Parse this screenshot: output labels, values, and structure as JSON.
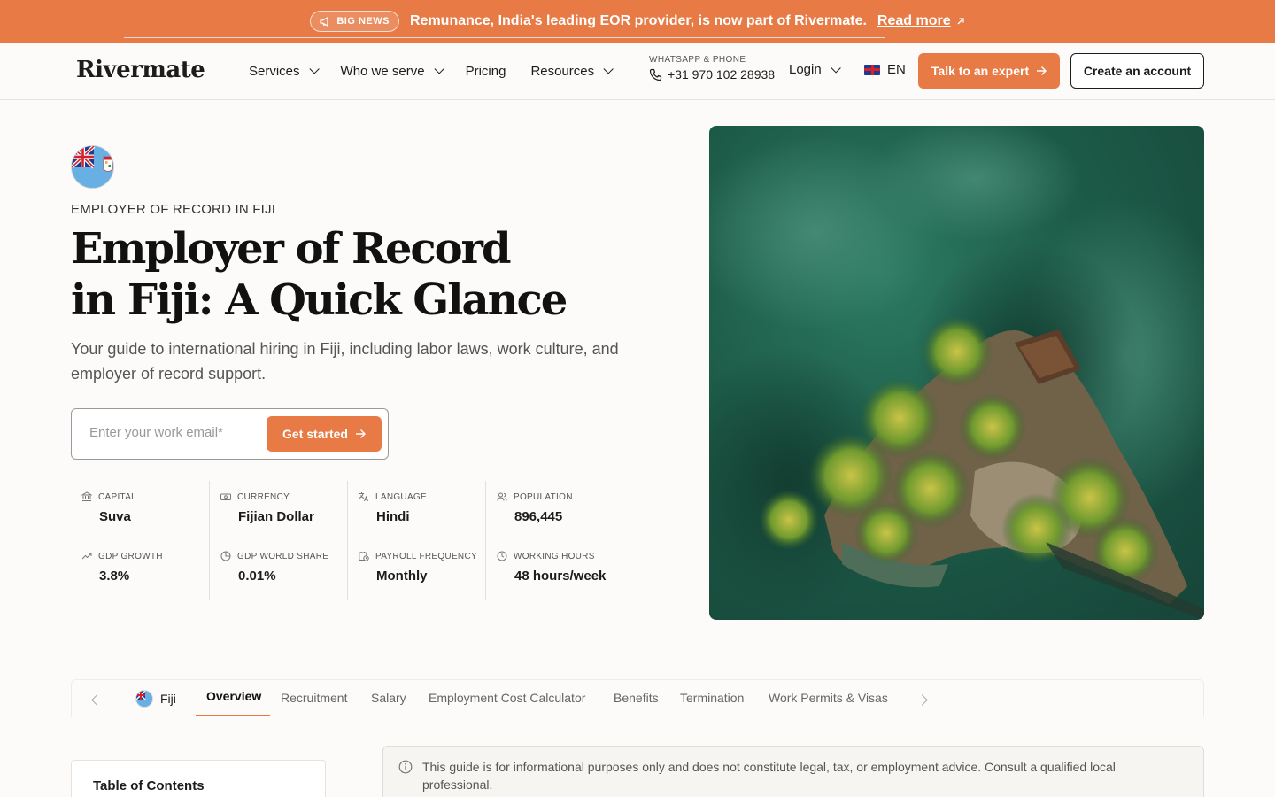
{
  "announcement": {
    "badge": "BIG NEWS",
    "text": "Remunance, India's leading EOR provider, is now part of Rivermate.",
    "link": "Read more"
  },
  "header": {
    "logo": "Rivermate",
    "nav": [
      {
        "label": "Services",
        "dropdown": true
      },
      {
        "label": "Who we serve",
        "dropdown": true
      },
      {
        "label": "Pricing",
        "dropdown": false
      },
      {
        "label": "Resources",
        "dropdown": true
      }
    ],
    "contact_label": "WHATSAPP & PHONE",
    "phone": "+31 970 102 28938",
    "login": "Login",
    "language": "EN",
    "cta_primary": "Talk to an expert",
    "cta_secondary": "Create an account"
  },
  "hero": {
    "eyebrow": "EMPLOYER OF RECORD IN FIJI",
    "title_line1": "Employer of Record",
    "title_line2": "in Fiji: A Quick Glance",
    "subtitle": "Your guide to international hiring in Fiji, including labor laws, work culture, and employer of record support.",
    "email_placeholder": "Enter your work email*",
    "get_started": "Get started"
  },
  "stats": [
    {
      "label": "CAPITAL",
      "value": "Suva",
      "icon": "bank-icon"
    },
    {
      "label": "CURRENCY",
      "value": "Fijian Dollar",
      "icon": "banknote-icon"
    },
    {
      "label": "LANGUAGE",
      "value": "Hindi",
      "icon": "translate-icon"
    },
    {
      "label": "POPULATION",
      "value": "896,445",
      "icon": "users-icon"
    },
    {
      "label": "GDP GROWTH",
      "value": "3.8%",
      "icon": "trend-up-icon"
    },
    {
      "label": "GDP WORLD SHARE",
      "value": "0.01%",
      "icon": "pie-chart-icon"
    },
    {
      "label": "PAYROLL FREQUENCY",
      "value": "Monthly",
      "icon": "calendar-clock-icon"
    },
    {
      "label": "WORKING HOURS",
      "value": "48 hours/week",
      "icon": "clock-icon"
    }
  ],
  "tabs": {
    "country": "Fiji",
    "items": [
      "Overview",
      "Recruitment",
      "Salary",
      "Employment Cost Calculator",
      "Benefits",
      "Termination",
      "Work Permits & Visas"
    ],
    "active": "Overview"
  },
  "toc": {
    "title": "Table of Contents"
  },
  "disclaimer": "This guide is for informational purposes only and does not constitute legal, tax, or employment advice. Consult a qualified local professional.",
  "colors": {
    "accent": "#e77a45",
    "text": "#1c1c1c",
    "background": "#fcfbf9"
  }
}
